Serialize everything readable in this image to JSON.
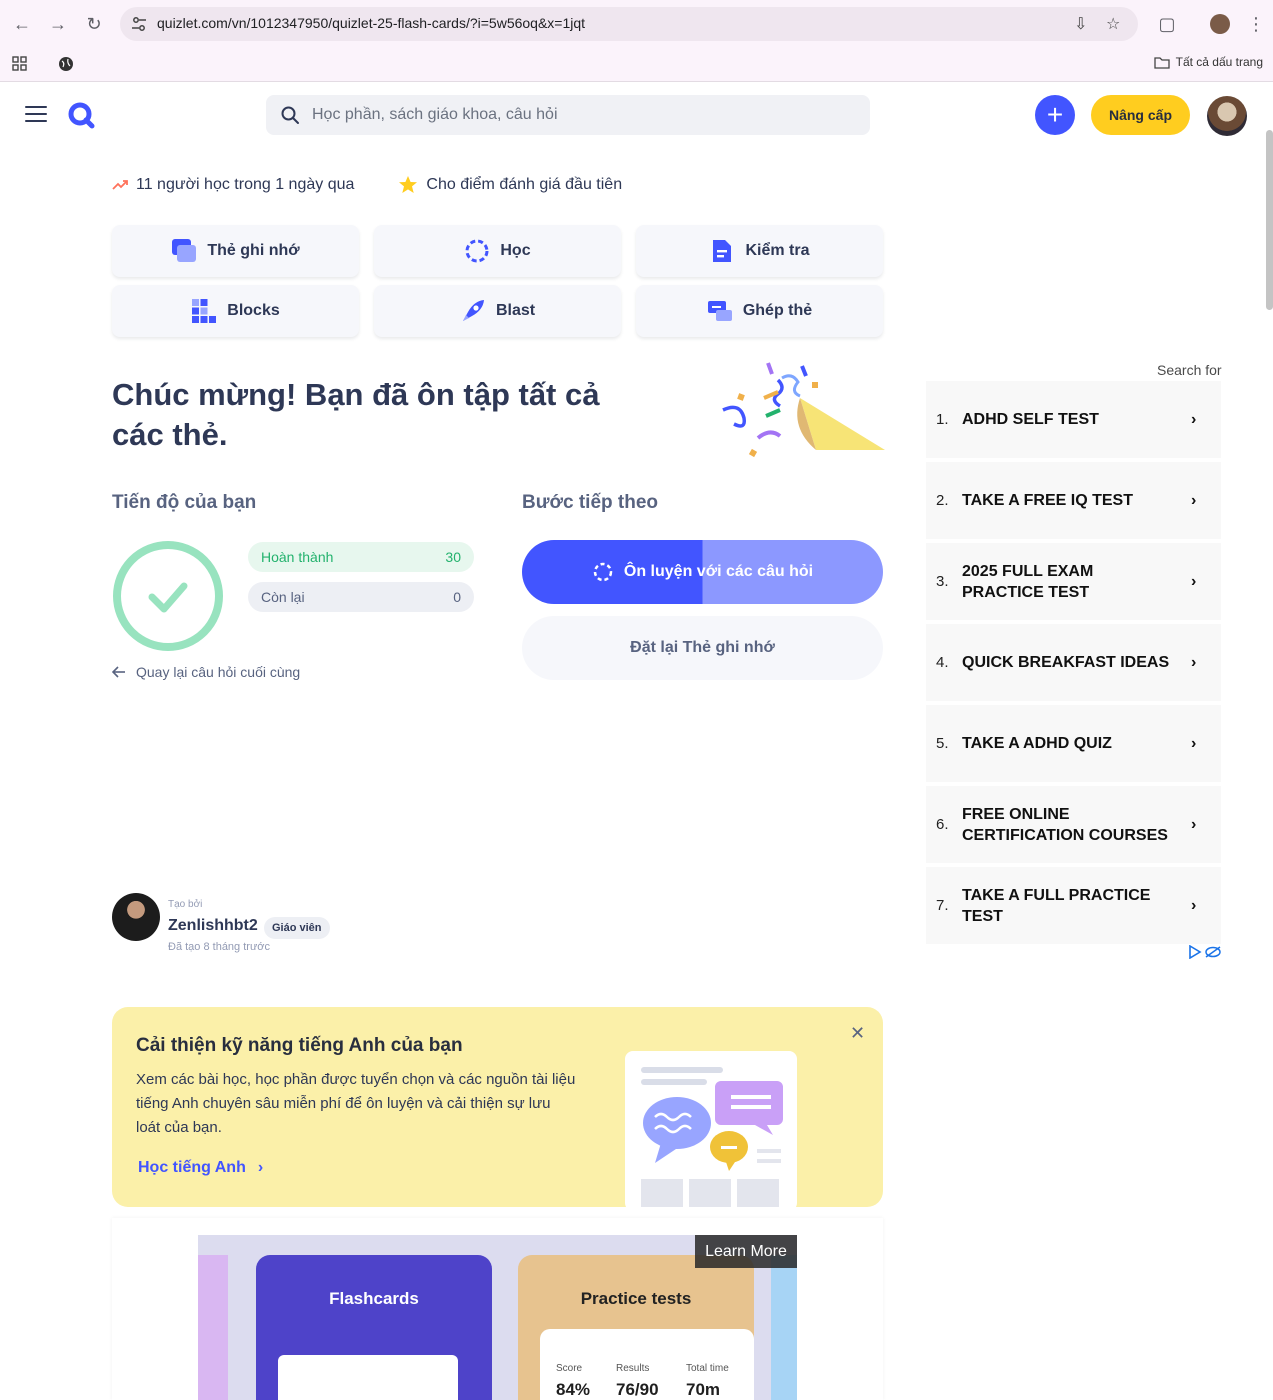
{
  "browser": {
    "url": "quizlet.com/vn/1012347950/quizlet-25-flash-cards/?i=5w56oq&x=1jqt",
    "bookmarks_folder": "Tất cả dấu trang"
  },
  "header": {
    "search_placeholder": "Học phần, sách giáo khoa, câu hỏi",
    "upgrade_label": "Nâng cấp"
  },
  "stats": {
    "learners": "11 người học trong 1 ngày qua",
    "rating": "Cho điểm đánh giá đầu tiên"
  },
  "modes": [
    {
      "label": "Thẻ ghi nhớ",
      "icon": "flashcards-icon"
    },
    {
      "label": "Học",
      "icon": "learn-icon"
    },
    {
      "label": "Kiểm tra",
      "icon": "test-icon"
    },
    {
      "label": "Blocks",
      "icon": "blocks-icon"
    },
    {
      "label": "Blast",
      "icon": "blast-icon"
    },
    {
      "label": "Ghép thẻ",
      "icon": "match-icon"
    }
  ],
  "congrats": "Chúc mừng! Bạn đã ôn tập tất cả các thẻ.",
  "progress": {
    "title": "Tiến độ của bạn",
    "done_label": "Hoàn thành",
    "done_count": "30",
    "remaining_label": "Còn lại",
    "remaining_count": "0",
    "back_link": "Quay lại câu hỏi cuối cùng"
  },
  "next": {
    "title": "Bước tiếp theo",
    "practice_label": "Ôn luyện với các câu hỏi",
    "practice_progress": 0.5,
    "reset_label": "Đặt lại Thẻ ghi nhớ"
  },
  "creator": {
    "created_by": "Tạo bởi",
    "name": "Zenlishhbt2",
    "badge": "Giáo viên",
    "created_when": "Đã tạo 8 tháng trước"
  },
  "promo": {
    "title": "Cải thiện kỹ năng tiếng Anh của bạn",
    "description": "Xem các bài học, học phần được tuyển chọn và các nguồn tài liệu tiếng Anh chuyên sâu miễn phí để ôn luyện và cải thiện sự lưu loát của bạn.",
    "link": "Học tiếng Anh"
  },
  "video_ad": {
    "learn_more": "Learn More",
    "card1_title": "Flashcards",
    "card2_title": "Practice tests",
    "score_label": "Score",
    "score_value": "84%",
    "results_label": "Results",
    "results_value": "76/90",
    "time_label": "Total time",
    "time_value": "70m"
  },
  "side_ad": {
    "header": "Search for",
    "items": [
      {
        "num": "1.",
        "label": "ADHD SELF TEST"
      },
      {
        "num": "2.",
        "label": "TAKE A FREE IQ TEST"
      },
      {
        "num": "3.",
        "label": "2025 FULL EXAM PRACTICE TEST"
      },
      {
        "num": "4.",
        "label": "QUICK BREAKFAST IDEAS"
      },
      {
        "num": "5.",
        "label": "TAKE A ADHD QUIZ"
      },
      {
        "num": "6.",
        "label": "FREE ONLINE CERTIFICATION COURSES"
      },
      {
        "num": "7.",
        "label": "TAKE A FULL PRACTICE TEST"
      }
    ]
  },
  "colors": {
    "brand": "#4255ff",
    "upgrade": "#ffcd1f",
    "success": "#23b26d",
    "promo_bg": "#fbf0a9"
  }
}
